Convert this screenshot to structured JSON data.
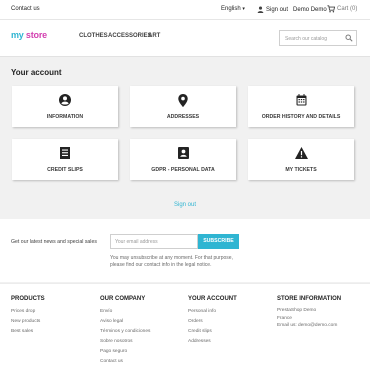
{
  "topbar": {
    "contact": "Contact us",
    "language": "English",
    "signout": "Sign out",
    "user": "Demo Demo",
    "cart": "Cart (0)"
  },
  "header": {
    "logo_my": "my",
    "logo_store": "store",
    "nav": [
      "CLOTHES",
      "ACCESSORIES",
      "ART"
    ],
    "search_placeholder": "Search our catalog"
  },
  "account": {
    "title": "Your account",
    "cards": [
      {
        "label": "INFORMATION",
        "icon": "user-circle-icon"
      },
      {
        "label": "ADDRESSES",
        "icon": "map-marker-icon"
      },
      {
        "label": "ORDER HISTORY AND DETAILS",
        "icon": "calendar-icon"
      },
      {
        "label": "CREDIT SLIPS",
        "icon": "document-icon"
      },
      {
        "label": "GDPR - PERSONAL DATA",
        "icon": "id-card-icon"
      },
      {
        "label": "MY TICKETS",
        "icon": "warning-icon"
      }
    ],
    "signout": "Sign out"
  },
  "newsletter": {
    "text": "Get our latest news and special sales",
    "email_placeholder": "Your email address",
    "subscribe": "SUBSCRIBE",
    "note1": "You may unsubscribe at any moment. For that purpose,",
    "note2": "please find our contact info in the legal notice."
  },
  "footer": {
    "products": {
      "title": "PRODUCTS",
      "items": [
        "Prices drop",
        "New products",
        "Best sales"
      ]
    },
    "company": {
      "title": "OUR COMPANY",
      "items": [
        "Envío",
        "Aviso legal",
        "Términos y condiciones",
        "Sobre nosotros",
        "Pago seguro",
        "Contact us"
      ]
    },
    "account": {
      "title": "YOUR ACCOUNT",
      "items": [
        "Personal info",
        "Orders",
        "Credit slips",
        "Addresses"
      ]
    },
    "store": {
      "title": "STORE INFORMATION",
      "items": [
        "PrestaShop Demo",
        "France",
        "Email us: demo@demo.com"
      ]
    }
  },
  "colors": {
    "accent": "#2fb5d2",
    "logo_pink": "#d33fb0"
  }
}
